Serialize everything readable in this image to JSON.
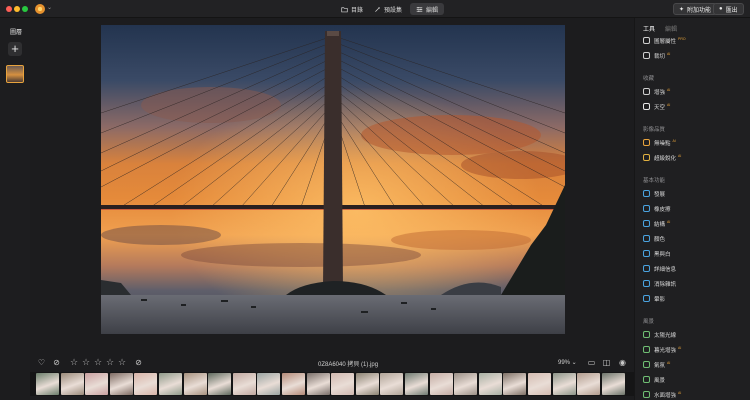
{
  "topbar": {
    "tabs": [
      {
        "label": "目錄",
        "icon": "folder-icon"
      },
      {
        "label": "預設集",
        "icon": "presets-icon"
      },
      {
        "label": "編輯",
        "icon": "sliders-icon"
      }
    ],
    "active_tab": "編輯",
    "addon_label": "附加功能",
    "export_label": "匯出"
  },
  "left": {
    "title": "圖層",
    "add_label": "+"
  },
  "bottom": {
    "filename": "0Z8A6040 拷貝 (1).jpg",
    "zoom": "99%",
    "rating": 0
  },
  "right": {
    "tabs": [
      "工具",
      "編輯"
    ],
    "items_top": [
      {
        "label": "圖層屬性",
        "tag": "PRO",
        "icon": "layer-properties-icon"
      },
      {
        "label": "裁切",
        "tag": "AI",
        "icon": "crop-icon"
      }
    ],
    "sections": [
      {
        "header": "收藏",
        "items": [
          {
            "label": "增強",
            "tag": "AI",
            "icon": "enhance-icon"
          },
          {
            "label": "天空",
            "tag": "AI",
            "icon": "sky-icon"
          }
        ]
      },
      {
        "header": "影像品質",
        "items": [
          {
            "label": "無噪點",
            "tag": "AI",
            "icon": "noiseless-icon"
          },
          {
            "label": "超級銳化",
            "tag": "AI",
            "icon": "supersharp-icon"
          }
        ]
      },
      {
        "header": "基本功能",
        "items": [
          {
            "label": "發展",
            "tag": "",
            "icon": "develop-icon"
          },
          {
            "label": "橡皮擦",
            "tag": "",
            "icon": "eraser-icon"
          },
          {
            "label": "結構",
            "tag": "AI",
            "icon": "structure-icon"
          },
          {
            "label": "顏色",
            "tag": "",
            "icon": "color-icon"
          },
          {
            "label": "黑與白",
            "tag": "",
            "icon": "black-white-icon"
          },
          {
            "label": "詳細信息",
            "tag": "",
            "icon": "details-icon"
          },
          {
            "label": "消除雜訊",
            "tag": "",
            "icon": "denoise-icon"
          },
          {
            "label": "暈影",
            "tag": "",
            "icon": "vignette-icon"
          }
        ]
      },
      {
        "header": "風景",
        "items": [
          {
            "label": "太陽光線",
            "tag": "",
            "icon": "sunrays-icon"
          },
          {
            "label": "暮光增強",
            "tag": "AI",
            "icon": "golden-hour-icon"
          },
          {
            "label": "氣氛",
            "tag": "AI",
            "icon": "atmosphere-icon"
          },
          {
            "label": "風景",
            "tag": "",
            "icon": "landscape-icon"
          },
          {
            "label": "水面增強",
            "tag": "AI",
            "icon": "water-icon"
          }
        ]
      }
    ]
  },
  "colors": {
    "accent": "#e8a33d",
    "background": "#1c1c1e",
    "panel": "#1f1f21"
  }
}
